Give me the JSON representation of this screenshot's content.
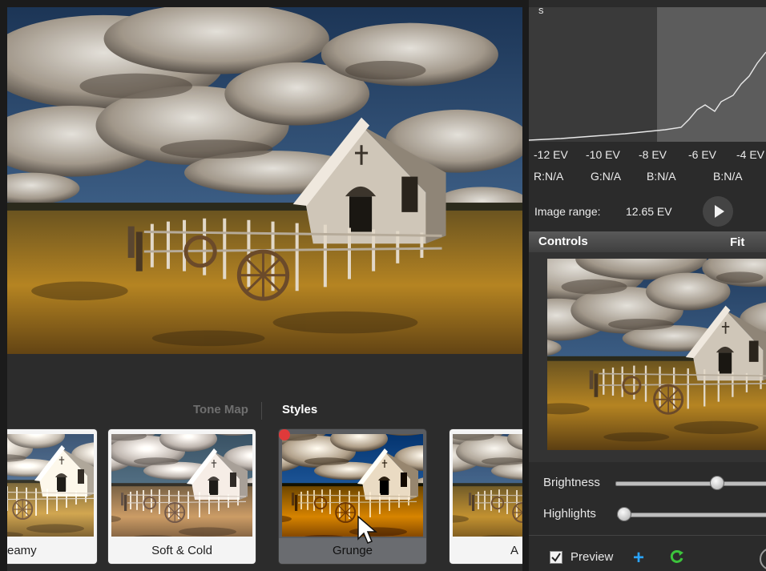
{
  "histogram": {
    "corner_letter": "s",
    "ev_labels": [
      "-12 EV",
      "-10 EV",
      "-8 EV",
      "-6 EV",
      "-4 EV"
    ],
    "rgb_labels": [
      "R:N/A",
      "G:N/A",
      "B:N/A",
      "B:N/A"
    ],
    "image_range_label": "Image range:",
    "image_range_value": "12.65 EV"
  },
  "controls": {
    "title": "Controls",
    "fit_label": "Fit",
    "brightness_label": "Brightness",
    "brightness_value": 0.63,
    "highlights_label": "Highlights",
    "highlights_value": 0.0,
    "preview_label": "Preview",
    "preview_checked": true
  },
  "tabs": {
    "tone_map": "Tone Map",
    "styles": "Styles",
    "active": "Styles"
  },
  "styles": [
    {
      "label": "eamy"
    },
    {
      "label": "Soft & Cold"
    },
    {
      "label": "Grunge",
      "selected": true
    },
    {
      "label": "A"
    }
  ],
  "colors": {
    "accent_blue": "#2aa4ff",
    "refresh_green": "#3cc43c",
    "active_tab": "#ffffff",
    "inactive_tab": "#6f6f6f"
  },
  "icons": [
    "play-icon",
    "checkbox-icon",
    "add-icon",
    "refresh-icon",
    "cursor-icon"
  ]
}
